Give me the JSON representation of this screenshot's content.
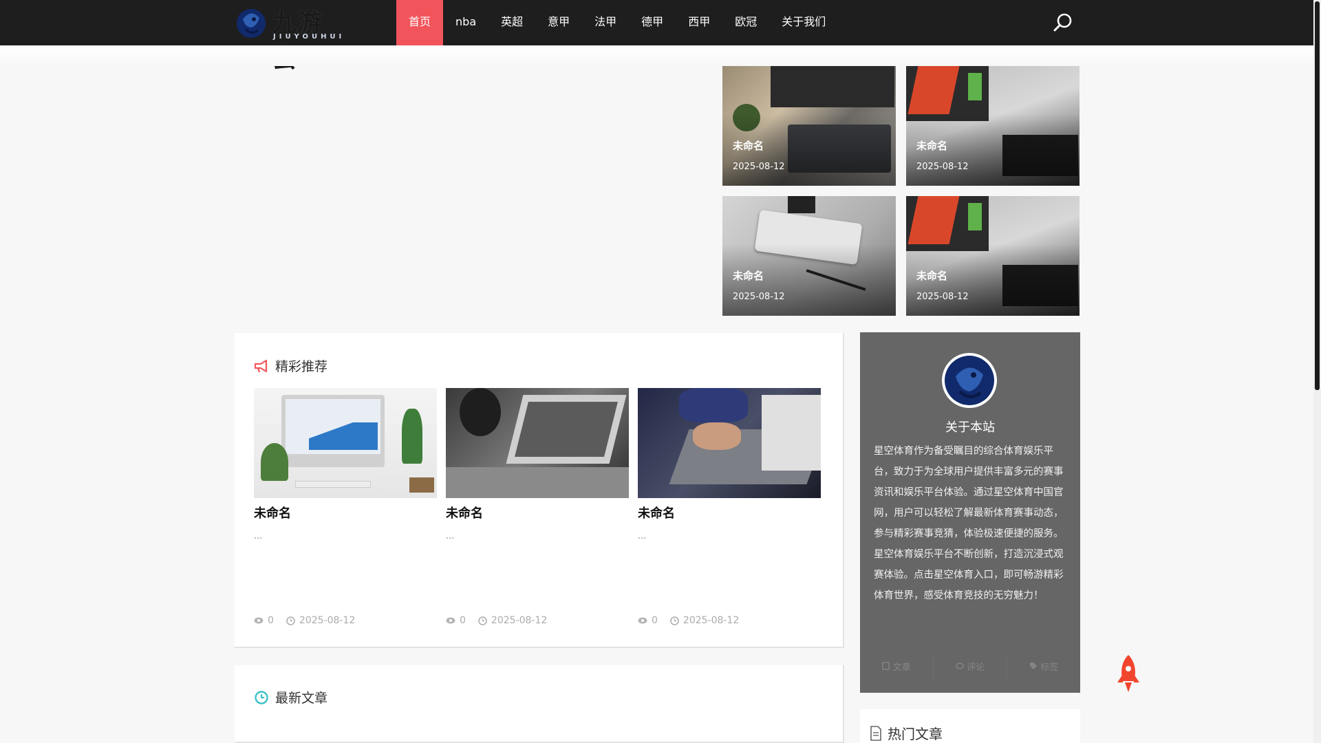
{
  "logo": {
    "text": "九游会",
    "subtext": "JIUYOUHUI"
  },
  "nav": {
    "items": [
      {
        "label": "首页",
        "active": true
      },
      {
        "label": "nba"
      },
      {
        "label": "英超"
      },
      {
        "label": "意甲"
      },
      {
        "label": "法甲"
      },
      {
        "label": "德甲"
      },
      {
        "label": "西甲"
      },
      {
        "label": "欧冠"
      },
      {
        "label": "关于我们"
      }
    ],
    "search_icon": "search-icon",
    "active_color": "#f2545b"
  },
  "featured": [
    {
      "title": "未命名",
      "date": "2025-08-12"
    },
    {
      "title": "未命名",
      "date": "2025-08-12"
    },
    {
      "title": "未命名",
      "date": "2025-08-12"
    },
    {
      "title": "未命名",
      "date": "2025-08-12"
    }
  ],
  "recommend": {
    "title": "精彩推荐",
    "icon": "megaphone-icon",
    "cards": [
      {
        "title": "未命名",
        "excerpt": "...",
        "views": "0",
        "date": "2025-08-12"
      },
      {
        "title": "未命名",
        "excerpt": "...",
        "views": "0",
        "date": "2025-08-12"
      },
      {
        "title": "未命名",
        "excerpt": "...",
        "views": "0",
        "date": "2025-08-12"
      }
    ]
  },
  "latest": {
    "title": "最新文章",
    "icon": "clock-icon"
  },
  "about": {
    "title": "关于本站",
    "text": "星空体育作为备受瞩目的综合体育娱乐平台，致力于为全球用户提供丰富多元的赛事资讯和娱乐平台体验。通过星空体育中国官网，用户可以轻松了解最新体育赛事动态，参与精彩赛事竞猜，体验极速便捷的服务。星空体育娱乐平台不断创新，打造沉浸式观赛体验。点击星空体育入口，即可畅游精彩体育世界，感受体育竞技的无穷魅力！",
    "tabs": [
      "文章",
      "评论",
      "标签"
    ]
  },
  "hot": {
    "title": "热门文章",
    "icon": "document-icon"
  },
  "back_to_top_icon": "rocket-icon"
}
